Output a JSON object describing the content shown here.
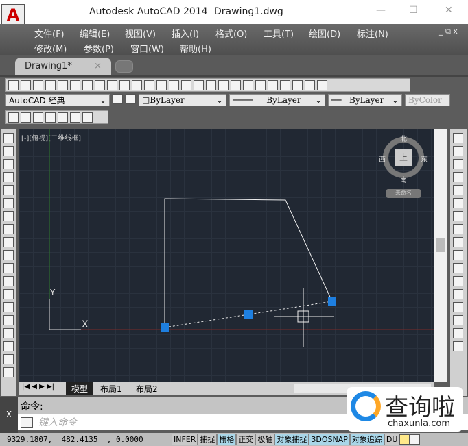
{
  "title": {
    "app": "Autodesk AutoCAD 2014",
    "file": "Drawing1.dwg",
    "minimize": "—",
    "maximize": "☐",
    "close": "✕"
  },
  "menu": {
    "row1": [
      "文件(F)",
      "编辑(E)",
      "视图(V)",
      "插入(I)",
      "格式(O)",
      "工具(T)",
      "绘图(D)",
      "标注(N)"
    ],
    "row2": [
      "修改(M)",
      "参数(P)",
      "窗口(W)",
      "帮助(H)"
    ],
    "win_controls": "_ ⧉ x"
  },
  "tabs": {
    "doc": "Drawing1*",
    "close": "×"
  },
  "toolbar": {
    "workspace": "AutoCAD 经典",
    "color": "□ByLayer",
    "linetype": "ByLayer",
    "lineweight": "ByLayer",
    "plotstyle": "ByColor"
  },
  "viewport": {
    "label": "[-][俯视][二维线框]",
    "compass": {
      "n": "北",
      "s": "南",
      "e": "东",
      "w": "西",
      "top": "上"
    },
    "ucs_name": "未命名"
  },
  "ucs": {
    "y": "Y",
    "x": "X"
  },
  "layout_tabs": [
    "模型",
    "布局1",
    "布局2"
  ],
  "command": {
    "history": "命令:",
    "placeholder": "键入命令",
    "close": "X"
  },
  "status": {
    "coords": "9329.1807,  482.4135  , 0.0000",
    "toggles": [
      {
        "label": "INFER",
        "on": false
      },
      {
        "label": "捕捉",
        "on": false
      },
      {
        "label": "栅格",
        "on": true
      },
      {
        "label": "正交",
        "on": false
      },
      {
        "label": "极轴",
        "on": false
      },
      {
        "label": "对象捕捉",
        "on": true
      },
      {
        "label": "3DOSNAP",
        "on": true
      },
      {
        "label": "对象追踪",
        "on": true
      },
      {
        "label": "DU",
        "on": false
      }
    ]
  },
  "watermark": {
    "name": "查询啦",
    "url": "chaxunla.com"
  },
  "colors": {
    "canvas": "#212833",
    "grip": "#1e7fe0"
  }
}
